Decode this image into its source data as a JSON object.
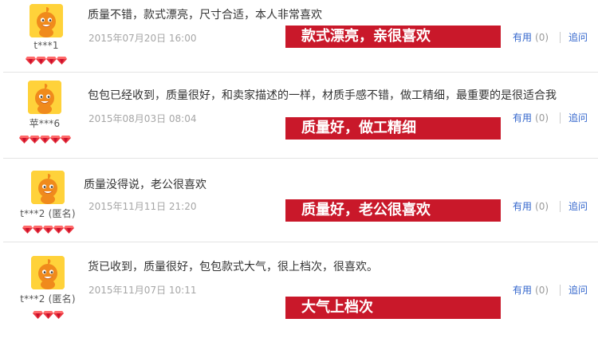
{
  "reviews": [
    {
      "username": "t***1",
      "gem_count": 4,
      "content": "质量不错，款式漂亮，尺寸合适，本人非常喜欢",
      "date": "2015年07月20日 16:00",
      "banner": "款式漂亮，亲很喜欢",
      "useful_label": "有用",
      "useful_count": "(0)",
      "ask_label": "追问"
    },
    {
      "username": "苹***6",
      "gem_count": 5,
      "content": "包包已经收到，质量很好，和卖家描述的一样，材质手感不错，做工精细，最重要的是很适合我",
      "date": "2015年08月03日 08:04",
      "banner": "质量好，做工精细",
      "useful_label": "有用",
      "useful_count": "(0)",
      "ask_label": "追问"
    },
    {
      "username": "t***2 (匿名)",
      "gem_count": 5,
      "content": "质量没得说，老公很喜欢",
      "date": "2015年11月11日 21:20",
      "banner": "质量好，老公很喜欢",
      "useful_label": "有用",
      "useful_count": "(0)",
      "ask_label": "追问"
    },
    {
      "username": "t***2 (匿名)",
      "gem_count": 3,
      "content": "货已收到，质量很好，包包款式大气，很上档次，很喜欢。",
      "date": "2015年11月07日 10:11",
      "banner": "大气上档次",
      "useful_label": "有用",
      "useful_count": "(0)",
      "ask_label": "追问"
    }
  ],
  "colors": {
    "banner_bg": "#c9182a",
    "link": "#3366cc",
    "gem": "#e8323c"
  },
  "icons": {
    "avatar": "orange-mascot-avatar-icon",
    "gem": "red-diamond-gem-icon"
  }
}
